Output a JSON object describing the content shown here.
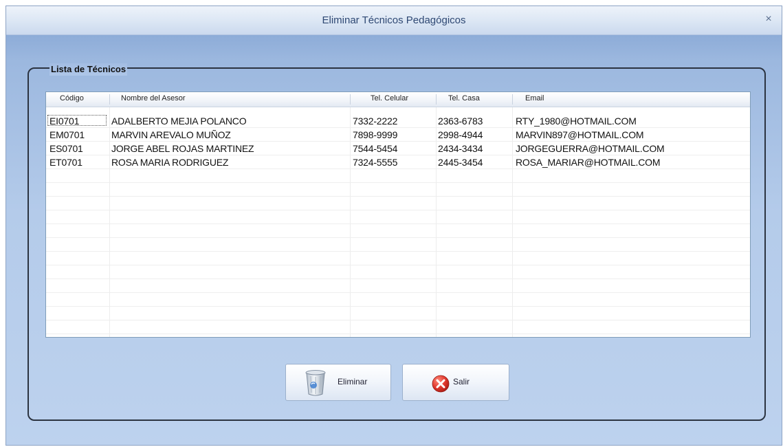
{
  "window": {
    "title": "Eliminar Técnicos Pedagógicos",
    "close_glyph": "×"
  },
  "group": {
    "label": "Lista de Técnicos"
  },
  "table": {
    "columns": [
      "Código",
      "Nombre del Asesor",
      "Tel. Celular",
      "Tel. Casa",
      "Email"
    ],
    "rows": [
      [
        "EI0701",
        "ADALBERTO MEJIA POLANCO",
        "7332-2222",
        "2363-6783",
        "RTY_1980@HOTMAIL.COM"
      ],
      [
        "EM0701",
        "MARVIN AREVALO MUÑOZ",
        "7898-9999",
        "2998-4944",
        "MARVIN897@HOTMAIL.COM"
      ],
      [
        "ES0701",
        "JORGE ABEL ROJAS MARTINEZ",
        "7544-5454",
        "2434-3434",
        "JORGEGUERRA@HOTMAIL.COM"
      ],
      [
        "ET0701",
        "ROSA MARIA RODRIGUEZ",
        "7324-5555",
        "2445-3454",
        "ROSA_MARIAR@HOTMAIL.COM"
      ]
    ]
  },
  "buttons": {
    "delete_label": "Eliminar",
    "exit_label": "Salir"
  },
  "icons": {
    "close": "close-icon",
    "delete": "recycle-bin-icon",
    "exit": "red-x-circle-icon"
  },
  "colors": {
    "window_gradient_top": "#7d9fd0",
    "window_gradient_bottom": "#bdd2ee",
    "title_text": "#2e4873",
    "exit_icon_red": "#d9302c"
  }
}
